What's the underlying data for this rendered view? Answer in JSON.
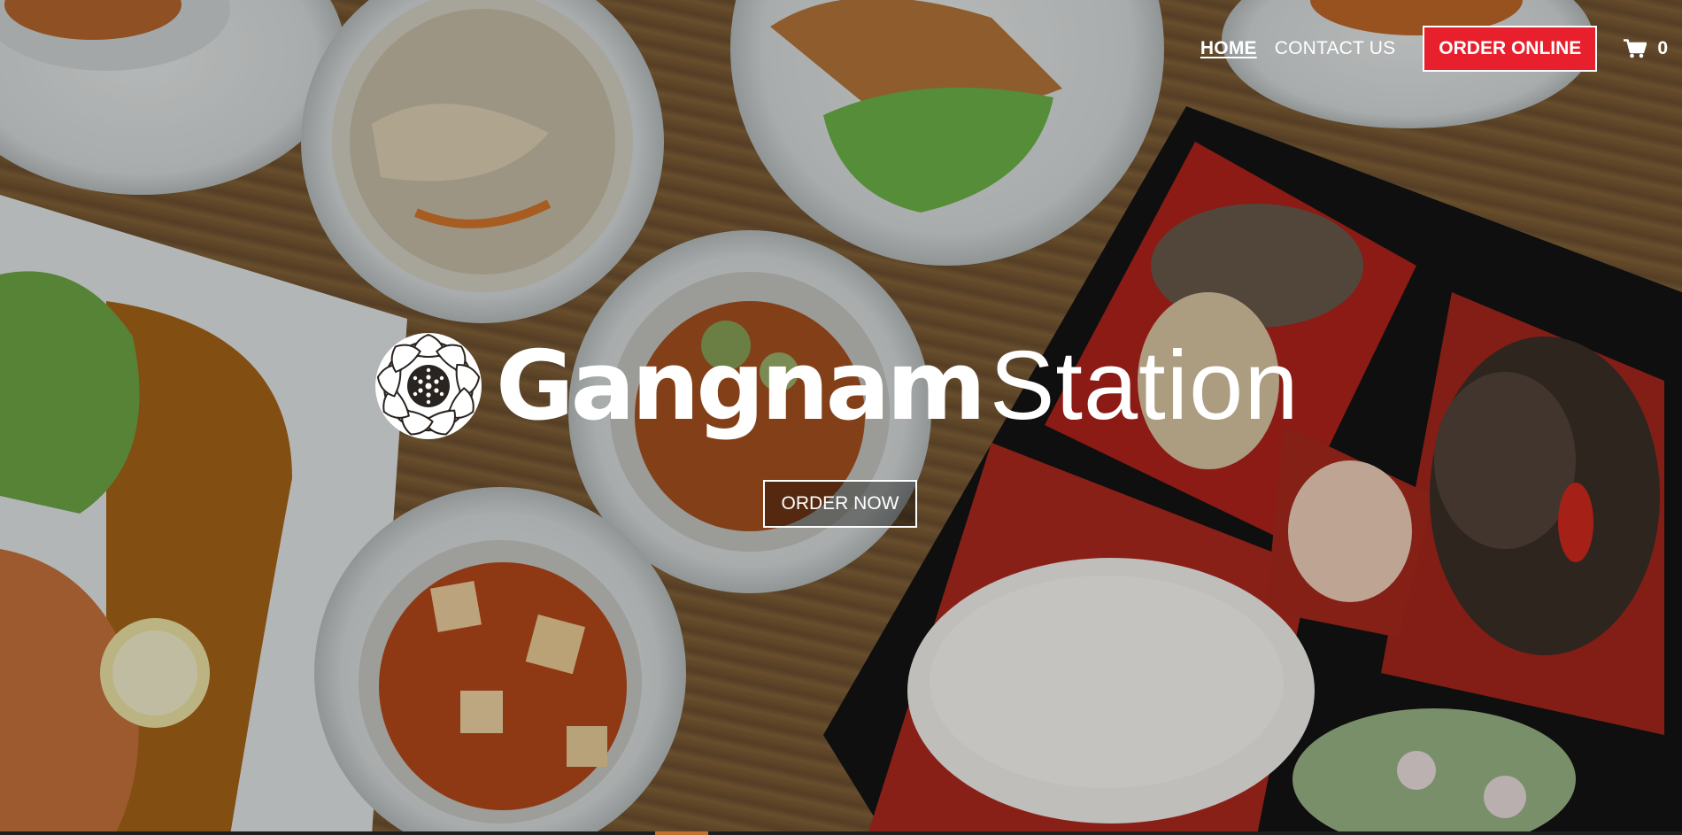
{
  "nav": {
    "home_label": "HOME",
    "contact_label": "CONTACT US",
    "order_online_label": "ORDER ONLINE",
    "cart_count": "0",
    "cart_icon": "shopping-cart-icon",
    "accent_color": "#e8202e"
  },
  "hero": {
    "logo_bold": "Gangnam",
    "logo_light": "Station",
    "logo_icon": "flower-emblem-icon",
    "order_now_label": "ORDER NOW"
  }
}
